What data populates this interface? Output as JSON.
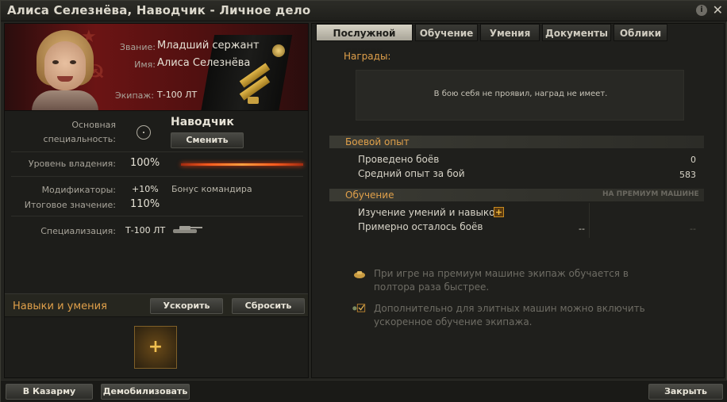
{
  "window": {
    "title": "Алиса Селезнёва, Наводчик - Личное дело",
    "info_icon": "info-icon",
    "close_icon": "close-icon"
  },
  "portrait": {
    "rank_label": "Звание:",
    "rank_value": "Младший сержант",
    "name_label": "Имя:",
    "name_value": "Алиса Селезнёва",
    "crew_label": "Экипаж:",
    "crew_value": "Т-100 ЛТ"
  },
  "specialty": {
    "label_line1": "Основная",
    "label_line2": "специальность:",
    "value": "Наводчик",
    "change_button": "Сменить"
  },
  "proficiency": {
    "label": "Уровень владения:",
    "value": "100%",
    "level": 1.0
  },
  "modifiers": {
    "label": "Модификаторы:",
    "value": "+10%",
    "note": "Бонус командира"
  },
  "total": {
    "label": "Итоговое значение:",
    "value": "110%"
  },
  "specialization": {
    "label": "Специализация:",
    "value": "Т-100 ЛТ"
  },
  "skills": {
    "title": "Навыки и умения",
    "accelerate_button": "Ускорить",
    "reset_button": "Сбросить",
    "add_label": "+"
  },
  "tabs": [
    {
      "label": "Послужной список",
      "active": true
    },
    {
      "label": "Обучение",
      "active": false
    },
    {
      "label": "Умения",
      "active": false
    },
    {
      "label": "Документы",
      "active": false
    },
    {
      "label": "Облики",
      "active": false
    }
  ],
  "awards": {
    "label": "Награды:",
    "empty_text": "В бою себя не проявил, наград не имеет."
  },
  "combat": {
    "title": "Боевой опыт",
    "battles_label": "Проведено боёв",
    "battles_value": "0",
    "avg_xp_label": "Средний опыт за бой",
    "avg_xp_value": "583"
  },
  "training": {
    "title": "Обучение",
    "premium_tag": "НА ПРЕМИУМ МАШИНЕ",
    "skills_study_label": "Изучение умений и навыков:",
    "battles_left_label": "Примерно осталось боёв",
    "battles_left_value": "--",
    "battles_left_premium": "--"
  },
  "info": {
    "premium_text": "При игре на премиум машине экипаж обучается в полтора раза быстрее.",
    "elite_text": "Дополнительно для элитных машин можно включить ускоренное обучение экипажа."
  },
  "footer": {
    "barracks_button": "В Казарму",
    "demobilize_button": "Демобилизовать",
    "close_button": "Закрыть"
  },
  "colors": {
    "accent": "#e0a04a",
    "progress": "#ff6020"
  }
}
